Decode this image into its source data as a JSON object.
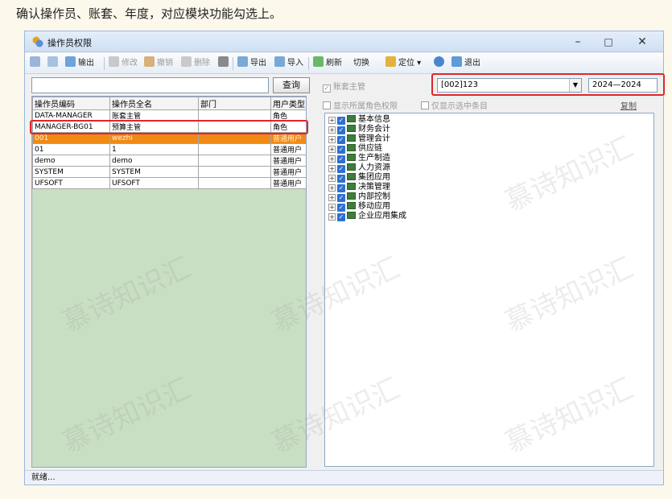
{
  "caption": "确认操作员、账套、年度，对应模块功能勾选上。",
  "window": {
    "title": "操作员权限",
    "controls": {
      "minimize": "–",
      "maximize": "□",
      "close": "✕"
    }
  },
  "toolbar": {
    "items": [
      {
        "label": "输出",
        "enabled": true
      },
      {
        "label": "修改",
        "enabled": false
      },
      {
        "label": "撤销",
        "enabled": false
      },
      {
        "label": "删除",
        "enabled": false
      },
      {
        "label": "导出",
        "enabled": true
      },
      {
        "label": "导入",
        "enabled": true
      },
      {
        "label": "刷新",
        "enabled": true
      },
      {
        "label": "切换",
        "enabled": true
      },
      {
        "label": "定位",
        "enabled": true
      },
      {
        "label": "退出",
        "enabled": true
      }
    ]
  },
  "search": {
    "query_label": "查询",
    "value": ""
  },
  "operators": {
    "columns": [
      "操作员编码",
      "操作员全名",
      "部门",
      "用户类型"
    ],
    "rows": [
      [
        "DATA-MANAGER",
        "账套主管",
        "",
        "角色"
      ],
      [
        "MANAGER-BG01",
        "预算主管",
        "",
        "角色"
      ],
      [
        "001",
        "wezhi",
        "",
        "普通用户"
      ],
      [
        "01",
        "1",
        "",
        "普通用户"
      ],
      [
        "demo",
        "demo",
        "",
        "普通用户"
      ],
      [
        "SYSTEM",
        "SYSTEM",
        "",
        "普通用户"
      ],
      [
        "UFSOFT",
        "UFSOFT",
        "",
        "普通用户"
      ]
    ],
    "selected_index": 2
  },
  "right": {
    "account_master_label": "账套主管",
    "show_role_label": "显示所属角色权限",
    "show_selected_label": "仅显示选中条目",
    "account_value": "[002]123",
    "year_value": "2024—2024",
    "copy_label": "复制",
    "modules": [
      "基本信息",
      "财务会计",
      "管理会计",
      "供应链",
      "生产制造",
      "人力资源",
      "集团应用",
      "决策管理",
      "内部控制",
      "移动应用",
      "企业应用集成"
    ]
  },
  "status": {
    "text": "就绪..."
  },
  "watermark": "慕诗知识汇",
  "colors": {
    "selected_row": "#f08a16",
    "highlight": "#e0262a",
    "grid_bg": "#c9dfc3"
  }
}
